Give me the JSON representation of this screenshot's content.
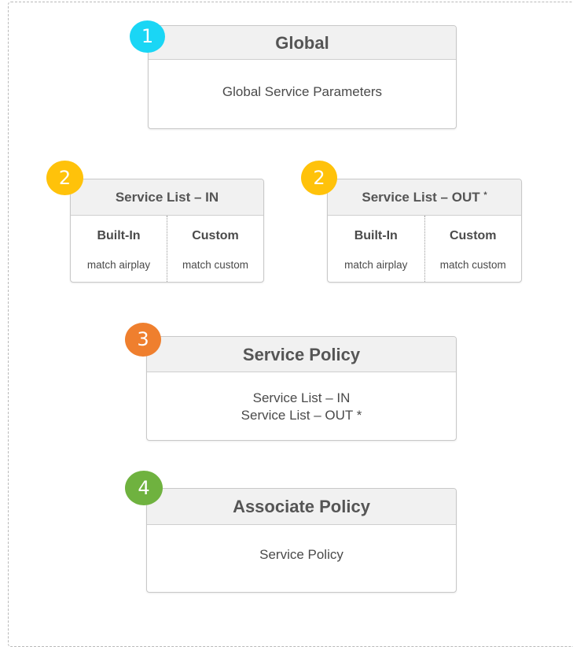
{
  "global": {
    "badge": "1",
    "badge_color": "#1ad6f5",
    "title": "Global",
    "body": "Global Service Parameters"
  },
  "service_list_in": {
    "badge": "2",
    "badge_color": "#ffc20a",
    "title": "Service List – IN",
    "columns": [
      {
        "title": "Built-In",
        "item": "match airplay"
      },
      {
        "title": "Custom",
        "item": "match custom"
      }
    ]
  },
  "service_list_out": {
    "badge": "2",
    "badge_color": "#ffc20a",
    "title": "Service List – OUT",
    "title_mark": "*",
    "columns": [
      {
        "title": "Built-In",
        "item": "match airplay"
      },
      {
        "title": "Custom",
        "item": "match custom"
      }
    ]
  },
  "service_policy": {
    "badge": "3",
    "badge_color": "#ef7f2e",
    "title": "Service Policy",
    "lines": [
      "Service List – IN",
      "Service List – OUT *"
    ]
  },
  "associate_policy": {
    "badge": "4",
    "badge_color": "#6fb23f",
    "title": "Associate Policy",
    "body": "Service Policy"
  }
}
